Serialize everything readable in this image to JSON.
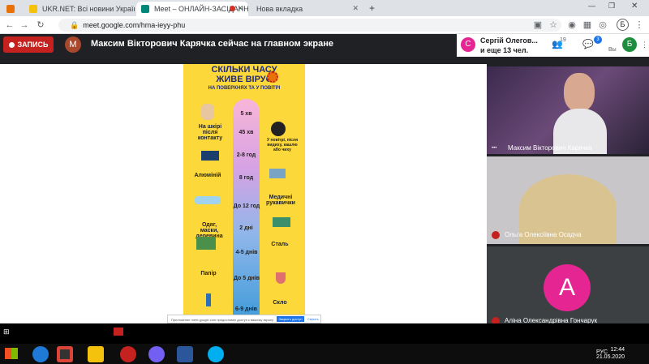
{
  "browser": {
    "tabs": [
      {
        "label": "UKR.NET: Всі новини України, о",
        "color": "#f4c20d"
      },
      {
        "label": "Meet – ОНЛАЙН-ЗАСІДАНН",
        "color": "#00897b"
      },
      {
        "label": "Нова вкладка",
        "color": "#dee1e6"
      }
    ],
    "new_tab_glyph": "+",
    "url": "meet.google.com/hma-ieyy-phu",
    "profile_letter": "Б"
  },
  "meeting": {
    "record_label": "ЗАПИСЬ",
    "presenter_initial": "M",
    "presenting_text": "Максим Вікторович Карячка сейчас на главном экране",
    "participant_initial": "С",
    "participant_line1": "Сергій Олегов...",
    "participant_line2": "и еще 13 чел.",
    "people_count": "19",
    "chat_count": "3",
    "user_label": "Вы",
    "user_initial": "Б"
  },
  "slide": {
    "title_line1": "СКІЛЬКИ ЧАСУ",
    "title_line2": "ЖИВЕ ВІРУС",
    "subtitle": "НА ПОВЕРХНЯХ ТА У ПОВІТРІ",
    "times": [
      "5 хв",
      "45 хв",
      "2-8 год",
      "8 год",
      "До 12 год",
      "2 дні",
      "4-5 днів",
      "До 5 днів",
      "6-9 днів"
    ],
    "left_labels": [
      "На шкірі після контакту",
      "Алюміній",
      "Одяг, маски, деревина",
      "Папір"
    ],
    "right_labels": [
      "У повітрі, після видиху, кашлю або чиху",
      "Медичні рукавички",
      "Сталь",
      "Скло"
    ]
  },
  "notification": {
    "text": "Приложение meet.google.com предоставил доступ к вашему экрану",
    "primary": "Закрыть доступ",
    "secondary": "Скрыть"
  },
  "participants": [
    {
      "name": "Максим Вікторович Карячка"
    },
    {
      "name": "Ольга Олексіївна Осадча"
    },
    {
      "name": "Аліна Олександрівна Гончарук",
      "initial": "А"
    }
  ],
  "taskbar": {
    "lang": "РУС",
    "time": "12:44",
    "date": "21.05.2020"
  }
}
